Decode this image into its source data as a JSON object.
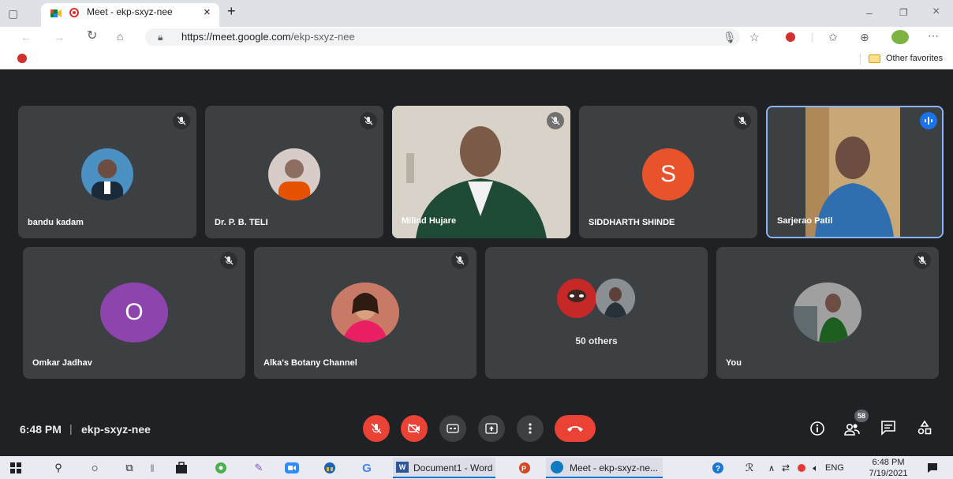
{
  "browser": {
    "tab_title": "Meet - ekp-sxyz-nee",
    "url_host": "https://meet.google.com",
    "url_path": "/ekp-sxyz-nee",
    "other_favorites": "Other favorites"
  },
  "tiles": [
    {
      "name": "bandu kadam",
      "muted": true
    },
    {
      "name": "Dr. P. B. TELI",
      "muted": true
    },
    {
      "name": "Milind Hujare",
      "muted": true
    },
    {
      "name": "SIDDHARTH SHINDE",
      "muted": true,
      "initial": "S",
      "avatar_color": "#e8532b"
    },
    {
      "name": "Sarjerao Patil",
      "muted": false,
      "speaking": true
    },
    {
      "name": "Omkar Jadhav",
      "muted": true,
      "initial": "O",
      "avatar_color": "#8e44ad"
    },
    {
      "name": "Alka's Botany Channel",
      "muted": true
    },
    {
      "name": "50 others"
    },
    {
      "name": "You",
      "muted": true
    }
  ],
  "meeting": {
    "time": "6:48 PM",
    "separator": "|",
    "code": "ekp-sxyz-nee",
    "participant_count": "58"
  },
  "taskbar": {
    "word_label": "Document1 - Word",
    "meet_label": "Meet - ekp-sxyz-ne...",
    "language": "ENG",
    "clock_time": "6:48 PM",
    "clock_date": "7/19/2021"
  },
  "colors": {
    "meet_bg": "#202124",
    "tile_bg": "#3c4043",
    "danger_red": "#ea4335",
    "speaking_blue": "#1a73e8"
  }
}
